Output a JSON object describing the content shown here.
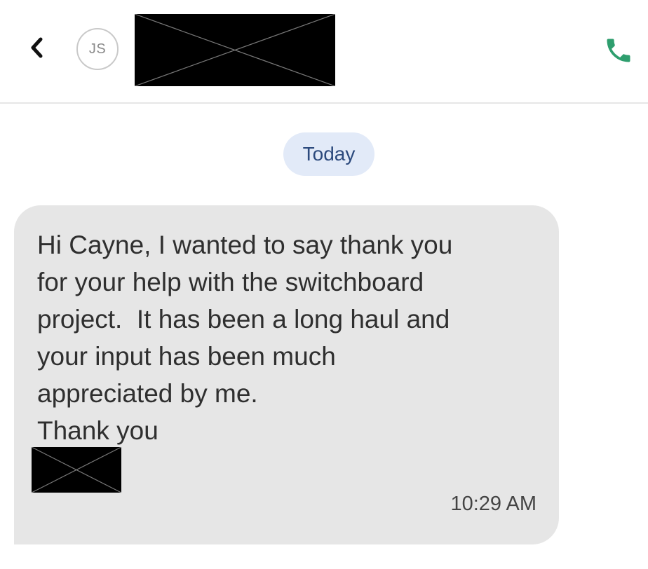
{
  "header": {
    "back_icon": "chevron-left-icon",
    "avatar_initials": "JS",
    "call_icon": "phone-icon",
    "call_icon_color": "#2e9e6e"
  },
  "conversation": {
    "date_label": "Today",
    "messages": [
      {
        "lines": [
          "Hi Cayne, I wanted to say thank you",
          "for your help with the switchboard",
          "project.  It has been a long haul and",
          "your input has been much",
          "appreciated by me.",
          "Thank you"
        ],
        "time": "10:29 AM"
      }
    ]
  },
  "colors": {
    "bubble_bg": "#e6e6e6",
    "date_pill_bg": "#e2eaf8",
    "date_pill_text": "#2c4a7d"
  }
}
